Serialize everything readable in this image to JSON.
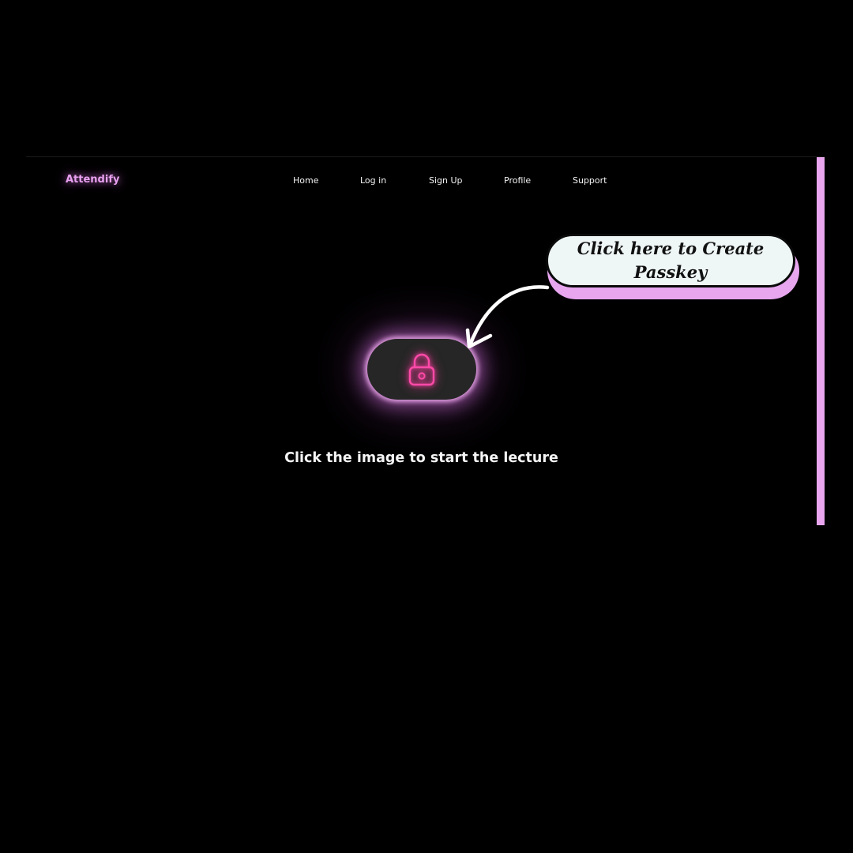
{
  "brand": {
    "name": "Attendify"
  },
  "nav": {
    "items": [
      {
        "label": "Home"
      },
      {
        "label": "Log in"
      },
      {
        "label": "Sign Up"
      },
      {
        "label": "Profile"
      },
      {
        "label": "Support"
      }
    ]
  },
  "main": {
    "lock_button": {
      "icon": "padlock-icon"
    },
    "caption": "Click the image to start the lecture"
  },
  "annotation": {
    "text": "Click here to Create Passkey",
    "arrow_icon": "curved-arrow-icon"
  },
  "colors": {
    "background": "#000000",
    "accent": "#e8a0ef",
    "lock_neon": "#ff3fa6",
    "button_fill": "#262626",
    "callout_fill": "#eff6f6"
  }
}
